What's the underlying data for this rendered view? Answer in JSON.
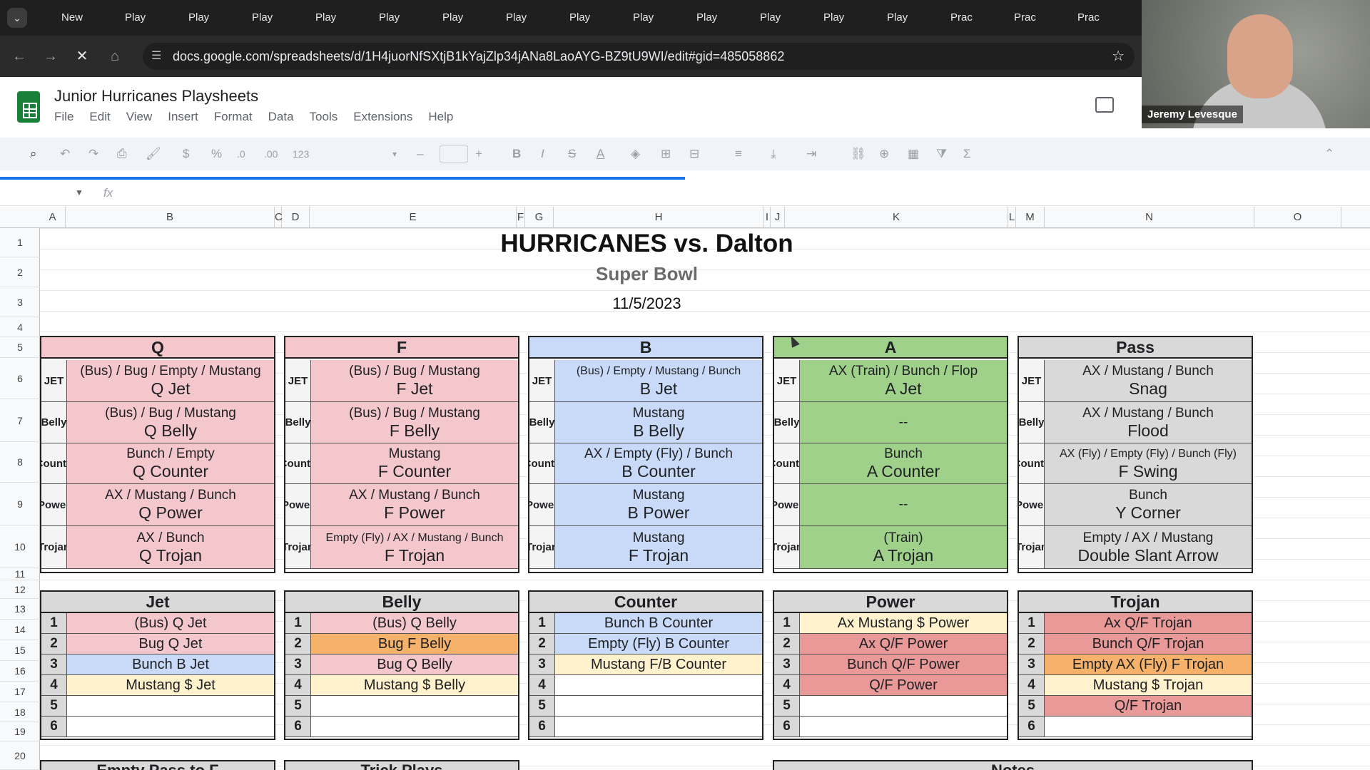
{
  "browser": {
    "tabs": [
      "New",
      "Play",
      "Play",
      "Play",
      "Play",
      "Play",
      "Play",
      "Play",
      "Play",
      "Play",
      "Play",
      "Play",
      "Play",
      "Play",
      "Prac",
      "Prac",
      "Prac"
    ],
    "url": "docs.google.com/spreadsheets/d/1H4juorNfSXtjB1kYajZlp34jANa8LaoAYG-BZ9tU9WI/edit#gid=485058862"
  },
  "sheet": {
    "title": "Junior Hurricanes Playsheets",
    "menu": [
      "File",
      "Edit",
      "View",
      "Insert",
      "Format",
      "Data",
      "Tools",
      "Extensions",
      "Help"
    ],
    "fx": "fx"
  },
  "columns": [
    "A",
    "B",
    "C",
    "D",
    "E",
    "F",
    "G",
    "H",
    "I",
    "J",
    "K",
    "L",
    "M",
    "N",
    "O"
  ],
  "rows": [
    "1",
    "2",
    "3",
    "4",
    "5",
    "6",
    "7",
    "8",
    "9",
    "10",
    "11",
    "12",
    "13",
    "14",
    "15",
    "16",
    "17",
    "18",
    "19",
    "20"
  ],
  "header": {
    "title": "HURRICANES vs. Dalton",
    "subtitle": "Super Bowl",
    "date": "11/5/2023"
  },
  "row_labels": [
    "JET",
    "Belly",
    "Counte",
    "Power",
    "Trojan"
  ],
  "groups": [
    {
      "name": "Q",
      "color": "#f4c7cd",
      "plays": [
        {
          "f": "(Bus) / Bug / Empty / Mustang",
          "p": "Q Jet"
        },
        {
          "f": "(Bus) / Bug / Mustang",
          "p": "Q Belly"
        },
        {
          "f": "Bunch / Empty",
          "p": "Q Counter"
        },
        {
          "f": "AX / Mustang / Bunch",
          "p": "Q Power"
        },
        {
          "f": "AX / Bunch",
          "p": "Q Trojan"
        }
      ]
    },
    {
      "name": "F",
      "color": "#f4c7cd",
      "plays": [
        {
          "f": "(Bus) / Bug / Mustang",
          "p": "F Jet"
        },
        {
          "f": "(Bus) / Bug / Mustang",
          "p": "F Belly"
        },
        {
          "f": "Mustang",
          "p": "F Counter"
        },
        {
          "f": "AX / Mustang / Bunch",
          "p": "F Power"
        },
        {
          "f": "Empty (Fly) / AX / Mustang / Bunch",
          "p": "F Trojan"
        }
      ]
    },
    {
      "name": "B",
      "color": "#c9daf8",
      "plays": [
        {
          "f": "(Bus) / Empty / Mustang / Bunch",
          "p": "B Jet"
        },
        {
          "f": "Mustang",
          "p": "B Belly"
        },
        {
          "f": "AX / Empty (Fly) / Bunch",
          "p": "B Counter"
        },
        {
          "f": "Mustang",
          "p": "B Power"
        },
        {
          "f": "Mustang",
          "p": "F Trojan"
        }
      ]
    },
    {
      "name": "A",
      "color": "#9fd18b",
      "plays": [
        {
          "f": "AX (Train) / Bunch / Flop",
          "p": "A Jet"
        },
        {
          "f": "--",
          "p": ""
        },
        {
          "f": "Bunch",
          "p": "A Counter"
        },
        {
          "f": "--",
          "p": ""
        },
        {
          "f": "(Train)",
          "p": "A Trojan"
        }
      ]
    },
    {
      "name": "Pass",
      "color": "#d9d9d9",
      "plays": [
        {
          "f": "AX / Mustang / Bunch",
          "p": "Snag"
        },
        {
          "f": "AX / Mustang / Bunch",
          "p": "Flood"
        },
        {
          "f": "AX (Fly) / Empty (Fly) / Bunch (Fly)",
          "p": "F Swing"
        },
        {
          "f": "Bunch",
          "p": "Y Corner"
        },
        {
          "f": "Empty / AX / Mustang",
          "p": "Double Slant Arrow"
        }
      ]
    }
  ],
  "lists": [
    {
      "name": "Jet",
      "items": [
        {
          "n": "1",
          "t": "(Bus) Q Jet",
          "c": "#f4c7cd"
        },
        {
          "n": "2",
          "t": "Bug Q Jet",
          "c": "#f4c7cd"
        },
        {
          "n": "3",
          "t": "Bunch B Jet",
          "c": "#c9daf8"
        },
        {
          "n": "4",
          "t": "Mustang $ Jet",
          "c": "#fff2cc"
        },
        {
          "n": "5",
          "t": "",
          "c": "#ffffff"
        },
        {
          "n": "6",
          "t": "",
          "c": "#ffffff"
        }
      ]
    },
    {
      "name": "Belly",
      "items": [
        {
          "n": "1",
          "t": "(Bus) Q Belly",
          "c": "#f4c7cd"
        },
        {
          "n": "2",
          "t": "Bug F Belly",
          "c": "#f6b26b"
        },
        {
          "n": "3",
          "t": "Bug Q Belly",
          "c": "#f4c7cd"
        },
        {
          "n": "4",
          "t": "Mustang $ Belly",
          "c": "#fff2cc"
        },
        {
          "n": "5",
          "t": "",
          "c": "#ffffff"
        },
        {
          "n": "6",
          "t": "",
          "c": "#ffffff"
        }
      ]
    },
    {
      "name": "Counter",
      "items": [
        {
          "n": "1",
          "t": "Bunch B Counter",
          "c": "#c9daf8"
        },
        {
          "n": "2",
          "t": "Empty (Fly) B Counter",
          "c": "#c9daf8"
        },
        {
          "n": "3",
          "t": "Mustang F/B Counter",
          "c": "#fff2cc"
        },
        {
          "n": "4",
          "t": "",
          "c": "#ffffff"
        },
        {
          "n": "5",
          "t": "",
          "c": "#ffffff"
        },
        {
          "n": "6",
          "t": "",
          "c": "#ffffff"
        }
      ]
    },
    {
      "name": "Power",
      "items": [
        {
          "n": "1",
          "t": "Ax Mustang $ Power",
          "c": "#fff2cc"
        },
        {
          "n": "2",
          "t": "Ax Q/F Power",
          "c": "#ea9999"
        },
        {
          "n": "3",
          "t": "Bunch Q/F Power",
          "c": "#ea9999"
        },
        {
          "n": "4",
          "t": "Q/F Power",
          "c": "#ea9999"
        },
        {
          "n": "5",
          "t": "",
          "c": "#ffffff"
        },
        {
          "n": "6",
          "t": "",
          "c": "#ffffff"
        }
      ]
    },
    {
      "name": "Trojan",
      "items": [
        {
          "n": "1",
          "t": "Ax Q/F Trojan",
          "c": "#ea9999"
        },
        {
          "n": "2",
          "t": "Bunch Q/F Trojan",
          "c": "#ea9999"
        },
        {
          "n": "3",
          "t": "Empty AX (Fly) F Trojan",
          "c": "#f6b26b"
        },
        {
          "n": "4",
          "t": "Mustang $ Trojan",
          "c": "#fff2cc"
        },
        {
          "n": "5",
          "t": "Q/F Trojan",
          "c": "#ea9999"
        },
        {
          "n": "6",
          "t": "",
          "c": "#ffffff"
        }
      ]
    }
  ],
  "bottom_headers": [
    "Empty Pass to F",
    "Trick Plays",
    "Notes"
  ],
  "webcam": {
    "name": "Jeremy Levesque"
  }
}
